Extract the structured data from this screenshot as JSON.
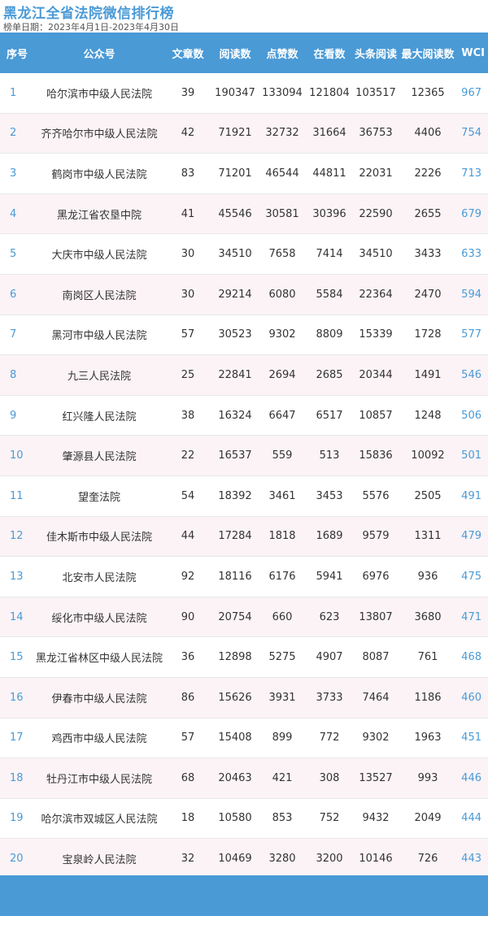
{
  "title": "黑龙江全省法院微信排行榜",
  "subtitle": "榜单日期：2023年4月1日-2023年4月30日",
  "colors": {
    "accent": "#4a9ad6",
    "stripe": "#fbf3f6"
  },
  "table": {
    "headers": [
      "序号",
      "公众号",
      "文章数",
      "阅读数",
      "点赞数",
      "在看数",
      "头条阅读",
      "最大阅读数",
      "WCI"
    ],
    "rows": [
      [
        "1",
        "哈尔滨市中级人民法院",
        "39",
        "190347",
        "133094",
        "121804",
        "103517",
        "12365",
        "967"
      ],
      [
        "2",
        "齐齐哈尔市中级人民法院",
        "42",
        "71921",
        "32732",
        "31664",
        "36753",
        "4406",
        "754"
      ],
      [
        "3",
        "鹤岗市中级人民法院",
        "83",
        "71201",
        "46544",
        "44811",
        "22031",
        "2226",
        "713"
      ],
      [
        "4",
        "黑龙江省农垦中院",
        "41",
        "45546",
        "30581",
        "30396",
        "22590",
        "2655",
        "679"
      ],
      [
        "5",
        "大庆市中级人民法院",
        "30",
        "34510",
        "7658",
        "7414",
        "34510",
        "3433",
        "633"
      ],
      [
        "6",
        "南岗区人民法院",
        "30",
        "29214",
        "6080",
        "5584",
        "22364",
        "2470",
        "594"
      ],
      [
        "7",
        "黑河市中级人民法院",
        "57",
        "30523",
        "9302",
        "8809",
        "15339",
        "1728",
        "577"
      ],
      [
        "8",
        "九三人民法院",
        "25",
        "22841",
        "2694",
        "2685",
        "20344",
        "1491",
        "546"
      ],
      [
        "9",
        "红兴隆人民法院",
        "38",
        "16324",
        "6647",
        "6517",
        "10857",
        "1248",
        "506"
      ],
      [
        "10",
        "肇源县人民法院",
        "22",
        "16537",
        "559",
        "513",
        "15836",
        "10092",
        "501"
      ],
      [
        "11",
        "望奎法院",
        "54",
        "18392",
        "3461",
        "3453",
        "5576",
        "2505",
        "491"
      ],
      [
        "12",
        "佳木斯市中级人民法院",
        "44",
        "17284",
        "1818",
        "1689",
        "9579",
        "1311",
        "479"
      ],
      [
        "13",
        "北安市人民法院",
        "92",
        "18116",
        "6176",
        "5941",
        "6976",
        "936",
        "475"
      ],
      [
        "14",
        "绥化市中级人民法院",
        "90",
        "20754",
        "660",
        "623",
        "13807",
        "3680",
        "471"
      ],
      [
        "15",
        "黑龙江省林区中级人民法院",
        "36",
        "12898",
        "5275",
        "4907",
        "8087",
        "761",
        "468"
      ],
      [
        "16",
        "伊春市中级人民法院",
        "86",
        "15626",
        "3931",
        "3733",
        "7464",
        "1186",
        "460"
      ],
      [
        "17",
        "鸡西市中级人民法院",
        "57",
        "15408",
        "899",
        "772",
        "9302",
        "1963",
        "451"
      ],
      [
        "18",
        "牡丹江市中级人民法院",
        "68",
        "20463",
        "421",
        "308",
        "13527",
        "993",
        "446"
      ],
      [
        "19",
        "哈尔滨市双城区人民法院",
        "18",
        "10580",
        "853",
        "752",
        "9432",
        "2049",
        "444"
      ],
      [
        "20",
        "宝泉岭人民法院",
        "32",
        "10469",
        "3280",
        "3200",
        "10146",
        "726",
        "443"
      ]
    ]
  }
}
